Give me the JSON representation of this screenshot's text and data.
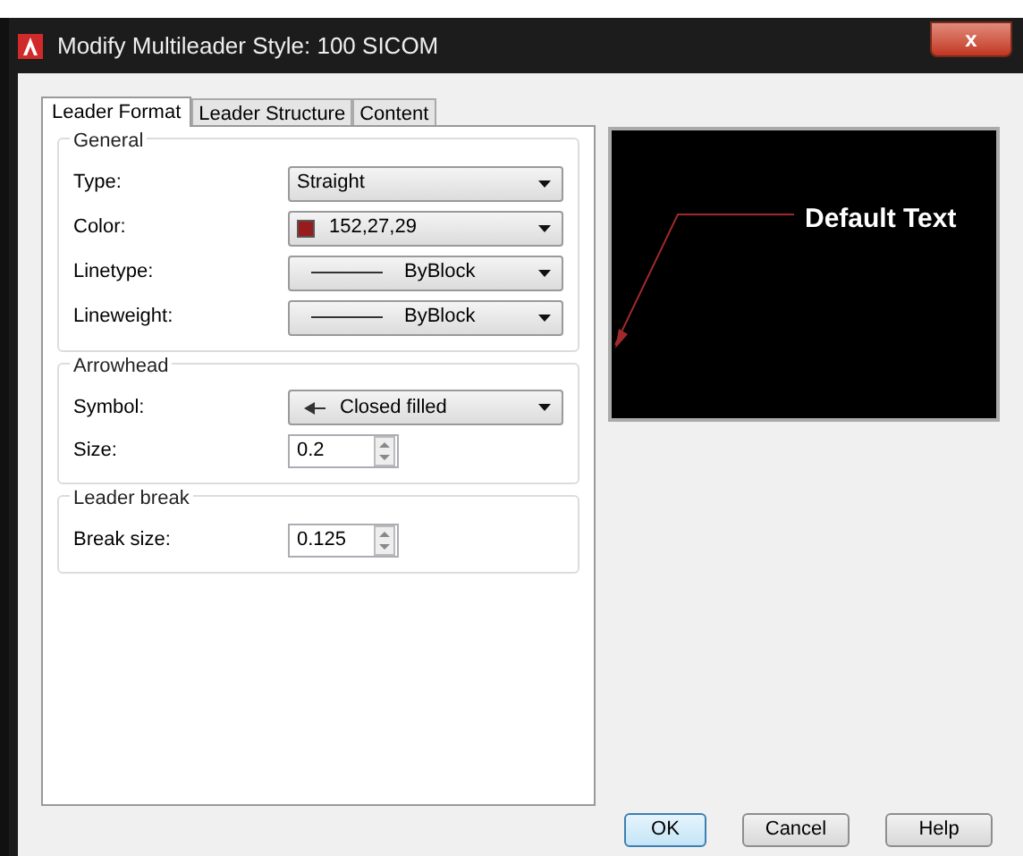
{
  "window": {
    "title": "Modify Multileader Style: 100 SICOM",
    "close": "x"
  },
  "tabs": [
    {
      "label": "Leader Format",
      "selected": true
    },
    {
      "label": "Leader Structure",
      "selected": false
    },
    {
      "label": "Content",
      "selected": false
    }
  ],
  "groups": [
    {
      "title": "General",
      "fields": [
        {
          "label": "Type:",
          "kind": "dropdown",
          "value": "Straight"
        },
        {
          "label": "Color:",
          "kind": "color",
          "value": "152,27,29",
          "color": "#981b1d"
        },
        {
          "label": "Linetype:",
          "kind": "line",
          "value": "ByBlock"
        },
        {
          "label": "Lineweight:",
          "kind": "line",
          "value": "ByBlock"
        }
      ]
    },
    {
      "title": "Arrowhead",
      "fields": [
        {
          "label": "Symbol:",
          "kind": "arrow",
          "value": "Closed filled"
        },
        {
          "label": "Size:",
          "kind": "spinner",
          "value": "0.2"
        }
      ]
    },
    {
      "title": "Leader break",
      "fields": [
        {
          "label": "Break size:",
          "kind": "spinner",
          "value": "0.125"
        }
      ]
    }
  ],
  "preview": {
    "text": "Default Text"
  },
  "buttons": [
    {
      "label": "OK",
      "default": true
    },
    {
      "label": "Cancel",
      "default": false
    },
    {
      "label": "Help",
      "default": false
    }
  ]
}
